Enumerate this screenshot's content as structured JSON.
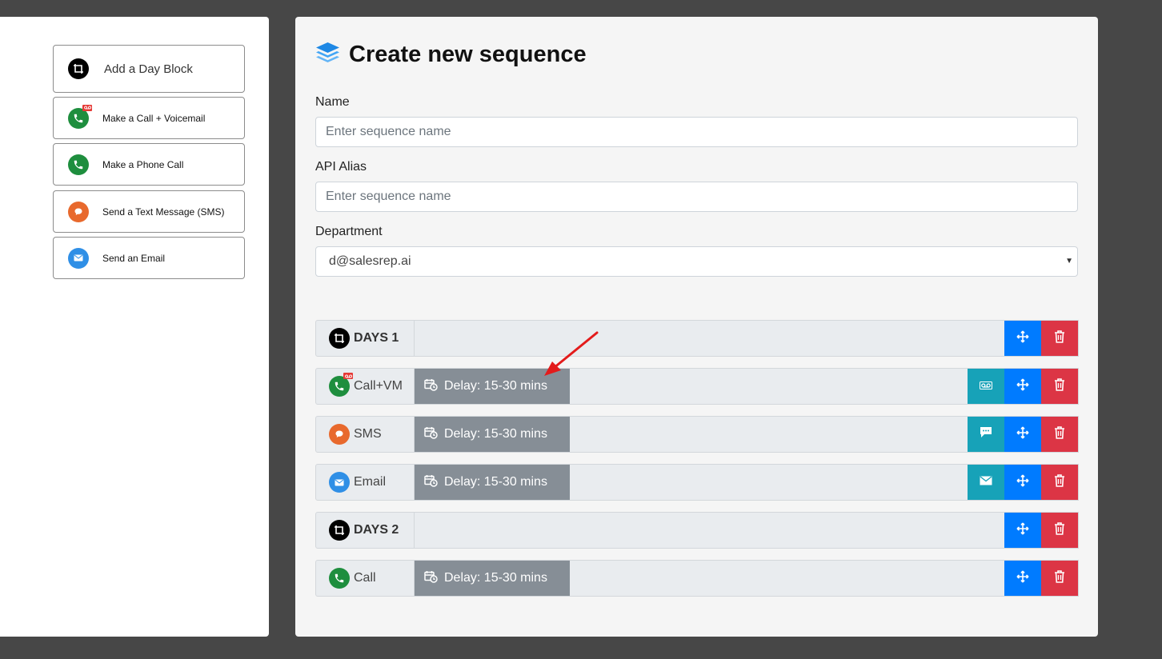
{
  "palette": {
    "items": [
      {
        "label": "Add a Day Block",
        "icon": "day-block-icon"
      },
      {
        "label": "Make a Call + Voicemail",
        "icon": "phone-voicemail-icon"
      },
      {
        "label": "Make a Phone Call",
        "icon": "phone-icon"
      },
      {
        "label": "Send a Text Message (SMS)",
        "icon": "chat-bubble-icon"
      },
      {
        "label": "Send an Email",
        "icon": "envelope-icon"
      }
    ]
  },
  "form": {
    "title": "Create new sequence",
    "name_label": "Name",
    "name_placeholder": "Enter sequence name",
    "alias_label": "API Alias",
    "alias_placeholder": "Enter sequence name",
    "department_label": "Department",
    "department_value": "d@salesrep.ai"
  },
  "sequence": {
    "rows": [
      {
        "type": "day",
        "label": "DAYS 1"
      },
      {
        "type": "step",
        "label": "Call+VM",
        "delay": "Delay: 15-30 mins",
        "action_icon": "voicemail-icon"
      },
      {
        "type": "step",
        "label": "SMS",
        "delay": "Delay: 15-30 mins",
        "action_icon": "chat-bubble-icon"
      },
      {
        "type": "step",
        "label": "Email",
        "delay": "Delay: 15-30 mins",
        "action_icon": "envelope-icon"
      },
      {
        "type": "day",
        "label": "DAYS 2"
      },
      {
        "type": "step",
        "label": "Call",
        "delay": "Delay: 15-30 mins"
      }
    ]
  },
  "colors": {
    "move": "#007bff",
    "delete": "#dc3545",
    "action": "#17a2b8",
    "delay": "#868e96",
    "annotation_arrow": "#e31b1b"
  }
}
